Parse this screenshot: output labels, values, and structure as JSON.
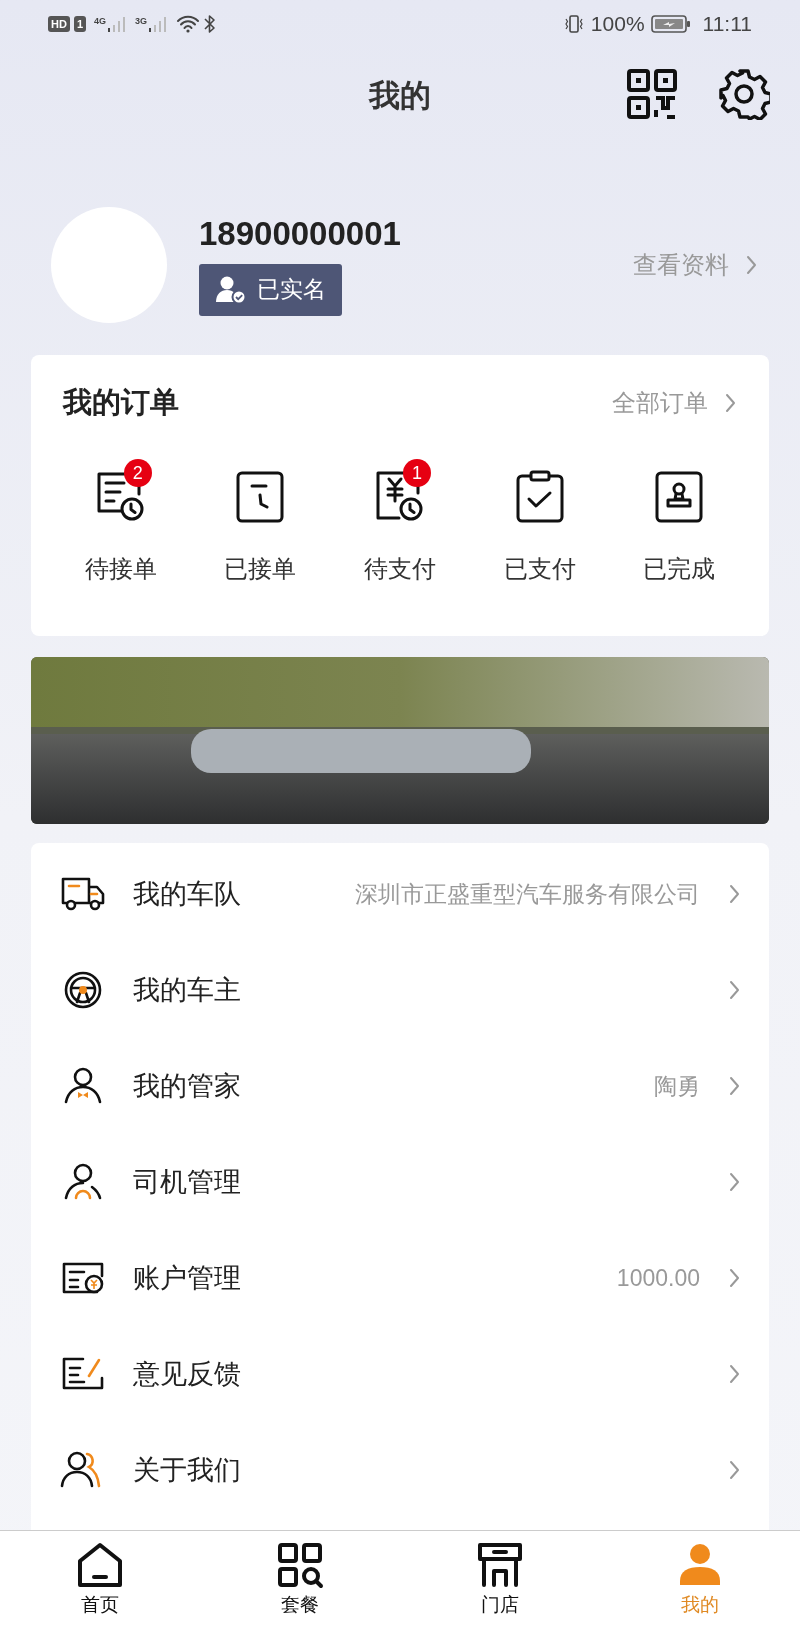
{
  "status_bar": {
    "sim_labels": [
      "HD",
      "1"
    ],
    "network_labels": [
      "4G",
      "3G"
    ],
    "battery": "100%",
    "time": "11:11"
  },
  "header": {
    "title": "我的"
  },
  "profile": {
    "phone": "18900000001",
    "verified_badge": "已实名",
    "view_link": "查看资料"
  },
  "orders": {
    "title": "我的订单",
    "all_link": "全部订单",
    "items": [
      {
        "kind": "pending-accept",
        "label": "待接单",
        "badge": "2"
      },
      {
        "kind": "accepted",
        "label": "已接单"
      },
      {
        "kind": "pending-pay",
        "label": "待支付",
        "badge": "1"
      },
      {
        "kind": "paid",
        "label": "已支付"
      },
      {
        "kind": "done",
        "label": "已完成"
      }
    ]
  },
  "menu": [
    {
      "kind": "fleet",
      "label": "我的车队",
      "value": "深圳市正盛重型汽车服务有限公司"
    },
    {
      "kind": "owner",
      "label": "我的车主"
    },
    {
      "kind": "butler",
      "label": "我的管家",
      "value": "陶勇"
    },
    {
      "kind": "driver",
      "label": "司机管理"
    },
    {
      "kind": "account",
      "label": "账户管理",
      "value": "1000.00"
    },
    {
      "kind": "feedback",
      "label": "意见反馈"
    },
    {
      "kind": "about",
      "label": "关于我们"
    }
  ],
  "tab_bar": [
    {
      "kind": "home",
      "label": "首页",
      "selected": false
    },
    {
      "kind": "packages",
      "label": "套餐",
      "selected": false
    },
    {
      "kind": "store",
      "label": "门店",
      "selected": false
    },
    {
      "kind": "me",
      "label": "我的",
      "selected": true
    }
  ]
}
